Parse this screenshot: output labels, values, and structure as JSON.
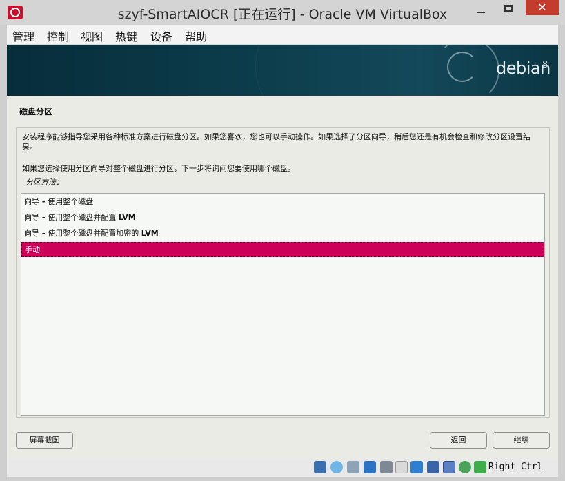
{
  "window": {
    "title": "szyf-SmartAIOCR [正在运行] - Oracle VM VirtualBox",
    "close_glyph": "✕"
  },
  "menubar": {
    "items": [
      "管理",
      "控制",
      "视图",
      "热键",
      "设备",
      "帮助"
    ]
  },
  "banner": {
    "logo_text": "debian",
    "logo_version": "8"
  },
  "installer": {
    "section_title": "磁盘分区",
    "description": "安装程序能够指导您采用各种标准方案进行磁盘分区。如果您喜欢，您也可以手动操作。如果选择了分区向导，稍后您还是有机会检查和修改分区设置结果。",
    "description2": "如果您选择使用分区向导对整个磁盘进行分区，下一步将询问您要使用哪个磁盘。",
    "method_label": "分区方法：",
    "options": [
      {
        "prefix": "向导",
        "dash": " - ",
        "text": "使用整个磁盘",
        "bold": ""
      },
      {
        "prefix": "向导",
        "dash": " - ",
        "text": "使用整个磁盘并配置 ",
        "bold": "LVM"
      },
      {
        "prefix": "向导",
        "dash": " - ",
        "text": "使用整个磁盘并配置加密的 ",
        "bold": "LVM"
      },
      {
        "prefix": "手动",
        "dash": "",
        "text": "",
        "bold": ""
      }
    ],
    "selected_index": 3,
    "selected_color": "#cc0059",
    "buttons": {
      "screenshot": "屏幕截图",
      "back": "返回",
      "continue": "继续"
    }
  },
  "statusbar": {
    "icons": [
      "hard-disk-icon",
      "optical-disk-icon",
      "audio-icon",
      "network-icon",
      "usb-icon",
      "shared-folders-icon",
      "display-icon",
      "capture-icon",
      "virtualization-icon",
      "mouse-integration-icon",
      "download-icon"
    ],
    "host_key": "Right Ctrl"
  }
}
